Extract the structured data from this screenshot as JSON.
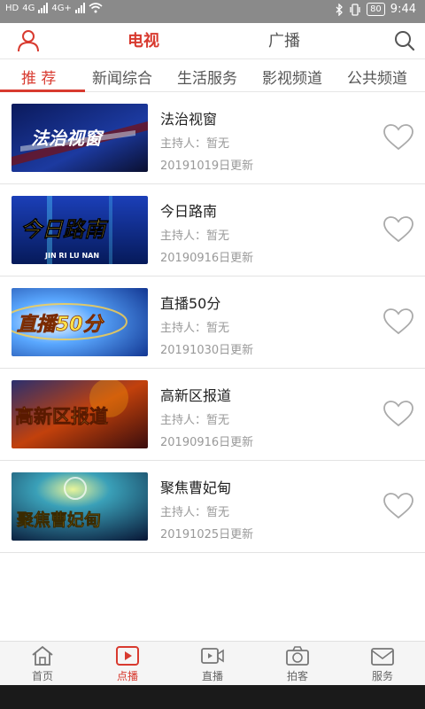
{
  "status_bar": {
    "left_indicators": [
      "HD",
      "4G",
      "4G+"
    ],
    "battery": "80",
    "time": "9:44"
  },
  "top_nav": {
    "user_icon": "user-icon",
    "tv_label": "电视",
    "radio_label": "广播",
    "search_icon": "search-icon"
  },
  "tabs": [
    {
      "label": "推 荐",
      "active": true
    },
    {
      "label": "新闻综合",
      "active": false
    },
    {
      "label": "生活服务",
      "active": false
    },
    {
      "label": "影视频道",
      "active": false
    },
    {
      "label": "公共频道",
      "active": false
    }
  ],
  "programs": [
    {
      "title": "法治视窗",
      "host": "主持人：暂无",
      "updated": "20191019日更新",
      "thumb_text": "法治视窗"
    },
    {
      "title": "今日路南",
      "host": "主持人：暂无",
      "updated": "20190916日更新",
      "thumb_text": "今日路南",
      "thumb_sub": "JIN RI LU NAN"
    },
    {
      "title": "直播50分",
      "host": "主持人：暂无",
      "updated": "20191030日更新",
      "thumb_text": "直播50分"
    },
    {
      "title": "高新区报道",
      "host": "主持人：暂无",
      "updated": "20190916日更新",
      "thumb_text": "高新区报道"
    },
    {
      "title": "聚焦曹妃甸",
      "host": "主持人：暂无",
      "updated": "20191025日更新",
      "thumb_text": "聚焦曹妃甸"
    }
  ],
  "bottom_nav": [
    {
      "label": "首页",
      "icon": "home-icon",
      "active": false
    },
    {
      "label": "点播",
      "icon": "play-icon",
      "active": true
    },
    {
      "label": "直播",
      "icon": "video-camera-icon",
      "active": false
    },
    {
      "label": "拍客",
      "icon": "camera-icon",
      "active": false
    },
    {
      "label": "服务",
      "icon": "mail-icon",
      "active": false
    }
  ],
  "colors": {
    "accent": "#d83a2f",
    "status_bar": "#8a8a8a"
  }
}
